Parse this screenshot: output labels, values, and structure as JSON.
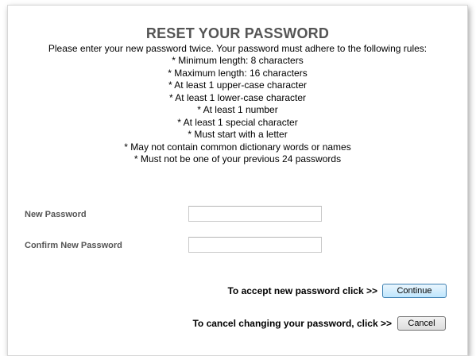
{
  "page": {
    "title": "RESET YOUR PASSWORD",
    "intro": "Please enter your new password twice. Your password must adhere to the following rules:",
    "rules": [
      "* Minimum length: 8 characters",
      "* Maximum length: 16 characters",
      "* At least 1 upper-case character",
      "* At least 1 lower-case character",
      "* At least 1 number",
      "* At least 1 special character",
      "* Must start with a letter",
      "* May not contain common dictionary words or names",
      "* Must not be one of your previous 24 passwords"
    ]
  },
  "form": {
    "new_password_label": "New Password",
    "new_password_value": "",
    "confirm_password_label": "Confirm New Password",
    "confirm_password_value": ""
  },
  "actions": {
    "accept_text": "To accept new password click >>",
    "continue_label": "Continue",
    "cancel_text": "To cancel changing your password, click >>",
    "cancel_label": "Cancel"
  },
  "colors": {
    "title": "#555555",
    "label": "#555555",
    "continue_border": "#3c7fb1"
  }
}
